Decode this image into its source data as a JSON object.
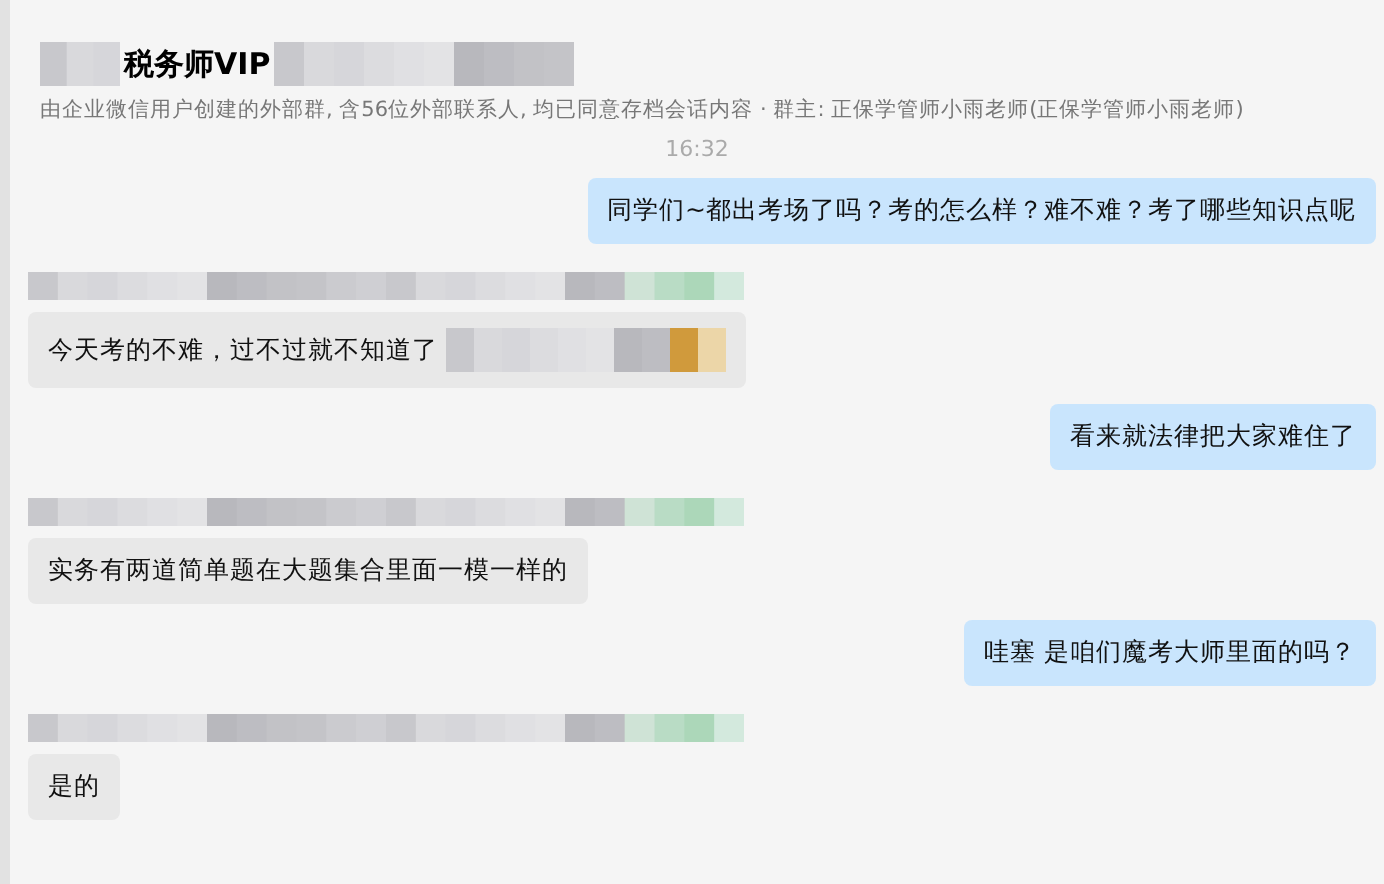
{
  "header": {
    "title": "税务师VIP",
    "redacted": true,
    "subtitle": "由企业微信用户创建的外部群, 含56位外部联系人, 均已同意存档会话内容 · 群主: 正保学管师小雨老师(正保学管师小雨老师)"
  },
  "time": "16:32",
  "messages": [
    {
      "kind": "out",
      "text": "同学们~都出考场了吗？考的怎么样？难不难？考了哪些知识点呢",
      "sender_hidden": false,
      "redacted_tail": false
    },
    {
      "kind": "in",
      "text": "今天考的不难，过不过就不知道了",
      "sender_hidden": true,
      "redacted_tail": true
    },
    {
      "kind": "out",
      "text": "看来就法律把大家难住了",
      "sender_hidden": false,
      "redacted_tail": false
    },
    {
      "kind": "in",
      "text": "实务有两道简单题在大题集合里面一模一样的",
      "sender_hidden": true,
      "redacted_tail": false
    },
    {
      "kind": "out",
      "text": "哇塞  是咱们魔考大师里面的吗？",
      "sender_hidden": false,
      "redacted_tail": false
    },
    {
      "kind": "in",
      "text": "是的",
      "sender_hidden": true,
      "redacted_tail": false
    }
  ]
}
